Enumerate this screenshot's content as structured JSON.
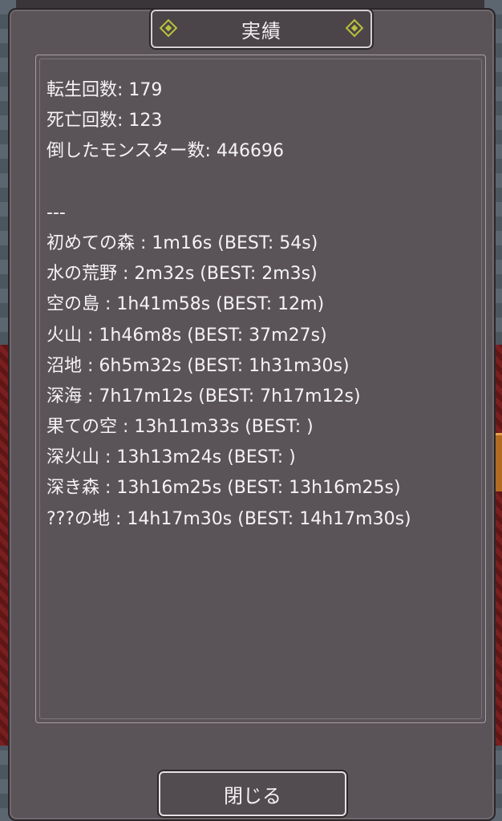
{
  "dialog": {
    "title": "実績",
    "close_label": "閉じる"
  },
  "stats": {
    "reincarnations": "転生回数: 179",
    "deaths": "死亡回数: 123",
    "monsters_defeated": "倒したモンスター数: 446696",
    "separator": "---",
    "areas": [
      "初めての森 : 1m16s (BEST: 54s)",
      "水の荒野 : 2m32s (BEST: 2m3s)",
      "空の島 : 1h41m58s (BEST: 12m)",
      "火山 : 1h46m8s (BEST: 37m27s)",
      "沼地 : 6h5m32s (BEST: 1h31m30s)",
      "深海 : 7h17m12s (BEST: 7h17m12s)",
      "果ての空 : 13h11m33s (BEST: )",
      "深火山 : 13h13m24s (BEST: )",
      "深き森 : 13h16m25s (BEST: 13h16m25s)",
      "???の地 : 14h17m30s (BEST: 14h17m30s)"
    ]
  },
  "colors": {
    "panel": "#5a5358",
    "accent": "#b9c23b",
    "text": "#f5f3f4"
  }
}
